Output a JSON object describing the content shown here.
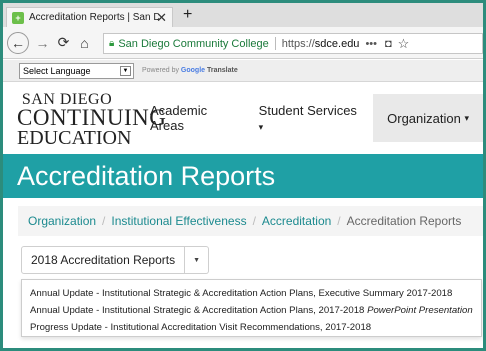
{
  "browser": {
    "tab_title": "Accreditation Reports | San Die",
    "tab_close": "✕",
    "new_tab": "+",
    "site_identity": "San Diego Community College",
    "url_prefix": "https://",
    "url_domain": "sdce.edu",
    "url_more": "•••"
  },
  "translate_bar": {
    "select_label": "Select Language",
    "powered_by": "Powered by",
    "google": "Google",
    "translate": "Translate"
  },
  "logo": {
    "line1": "SAN DIEGO",
    "line2": "CONTINUING",
    "line3": "EDUCATION"
  },
  "nav": {
    "academic_areas": "Academic Areas",
    "student_services": "Student Services",
    "organization": "Organization"
  },
  "page_title": "Accreditation Reports",
  "breadcrumb": {
    "items": [
      "Organization",
      "Institutional Effectiveness",
      "Accreditation"
    ],
    "current": "Accreditation Reports"
  },
  "dropdown": {
    "selected": "2018 Accreditation Reports",
    "options": [
      {
        "text": "Annual Update - Institutional Strategic & Accreditation Action Plans, Executive Summary 2017-2018",
        "italic": ""
      },
      {
        "text": "Annual Update - Institutional Strategic & Accreditation Action Plans, 2017-2018 ",
        "italic": "PowerPoint Presentation"
      },
      {
        "text": "Progress Update - Institutional Accreditation Visit Recommendations, 2017-2018",
        "italic": ""
      }
    ]
  },
  "colors": {
    "teal": "#1fa0a5",
    "link": "#1c8a8f",
    "secure_green": "#1a7a3a"
  }
}
